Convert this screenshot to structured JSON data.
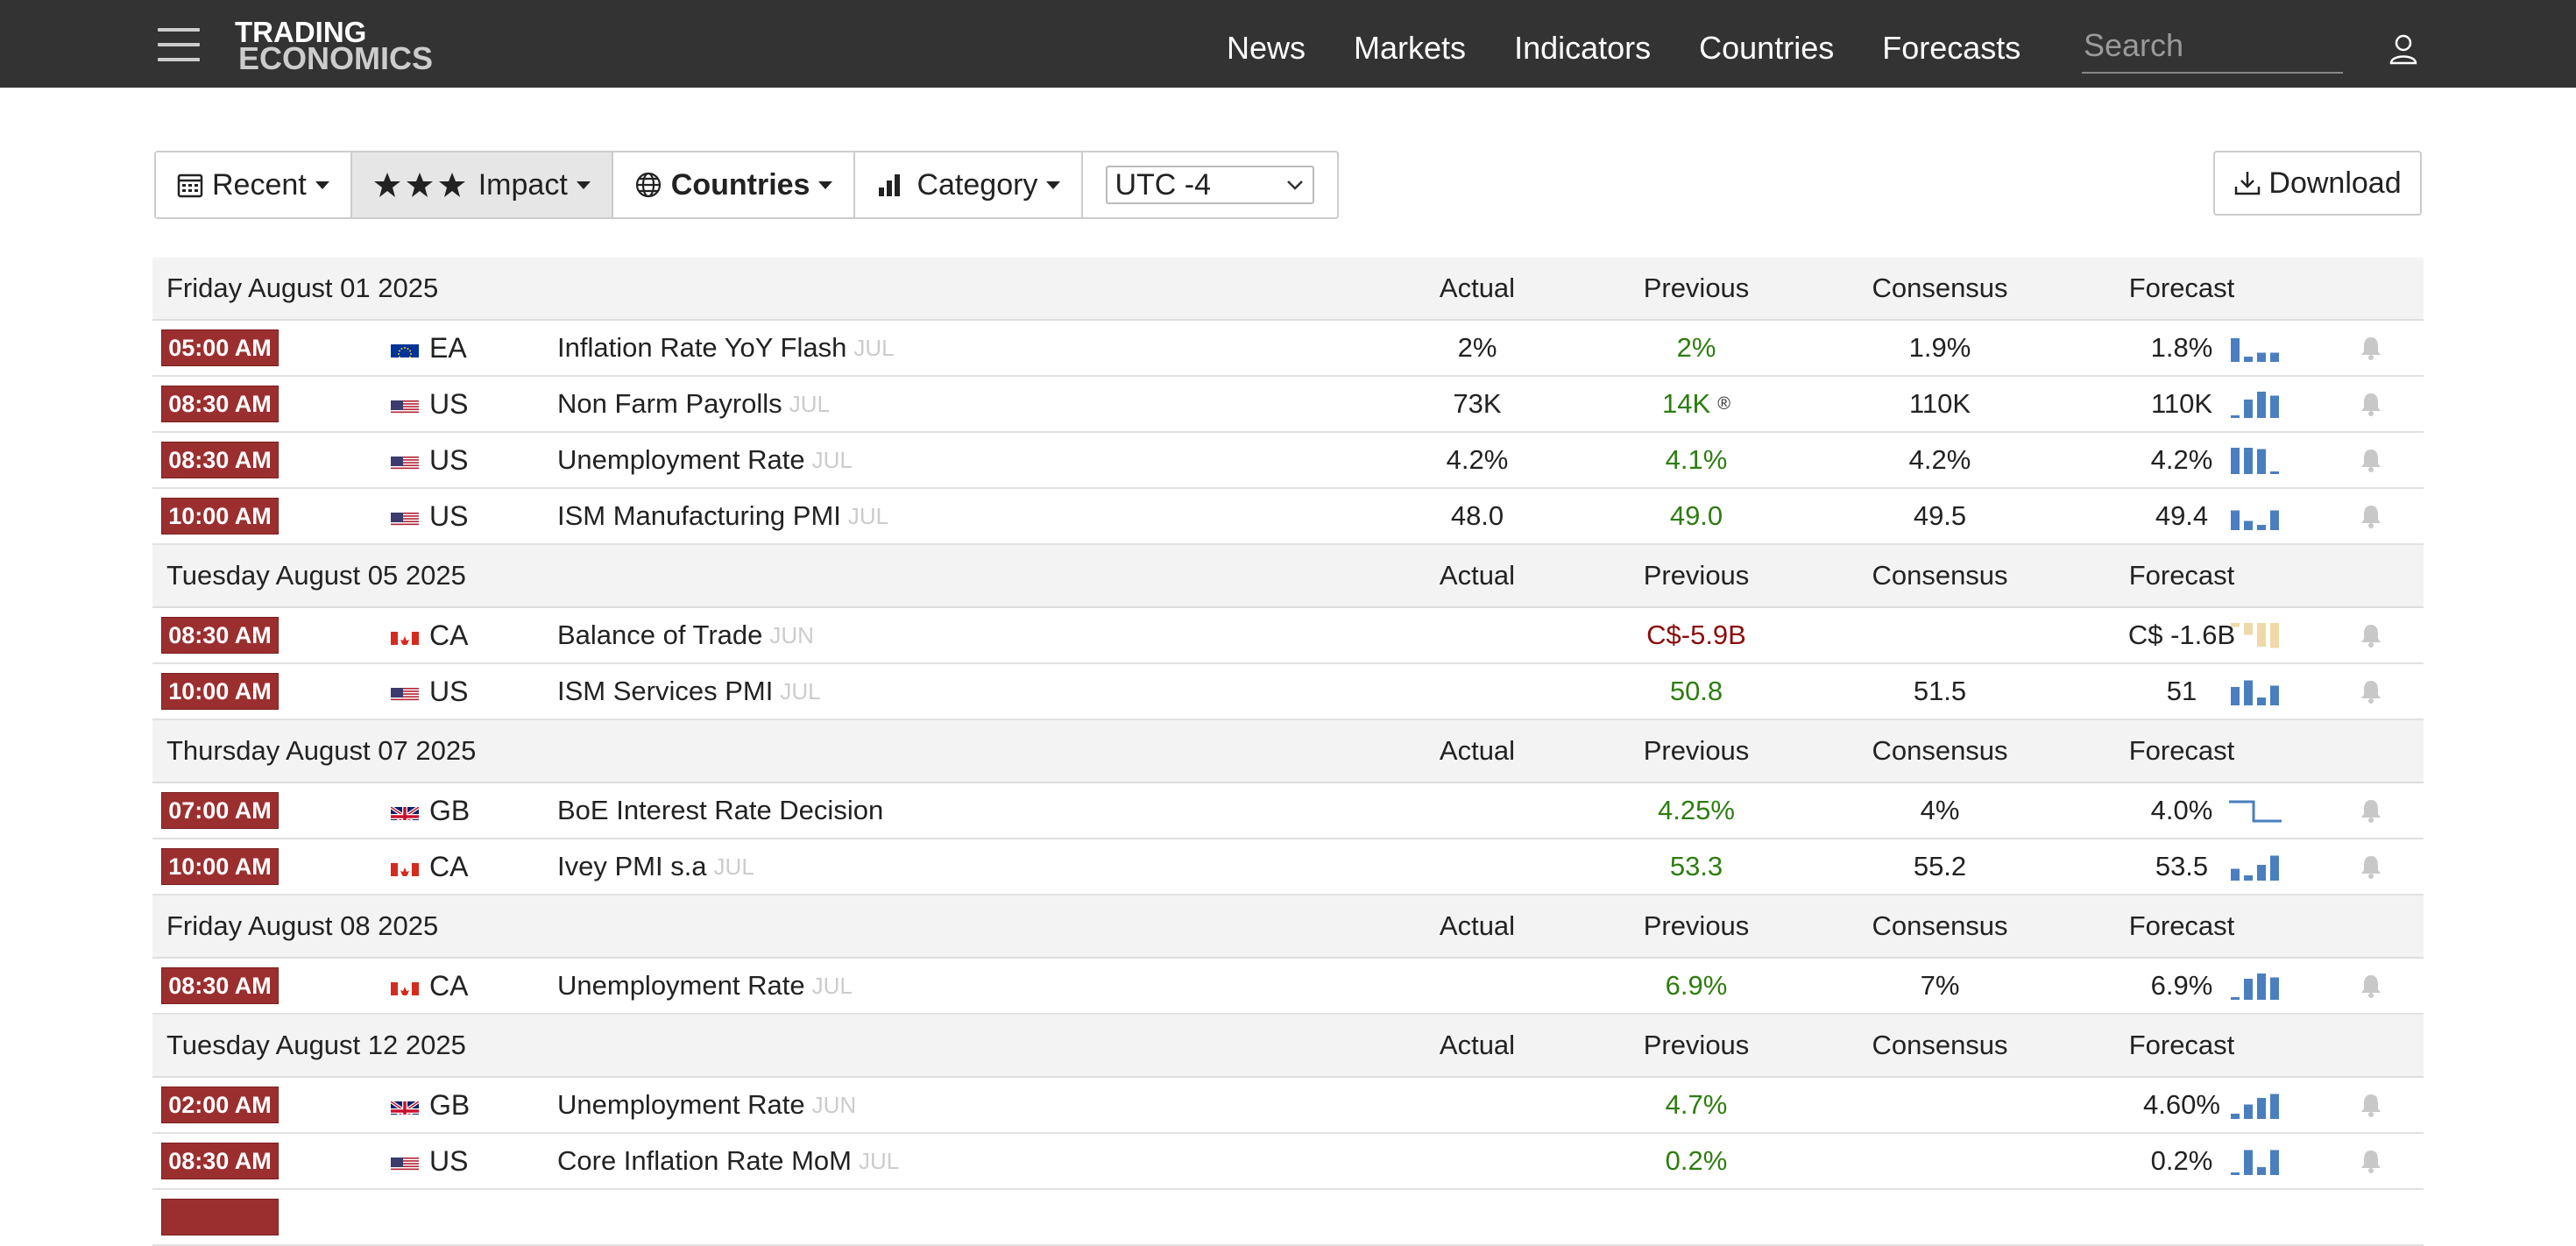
{
  "header": {
    "logo_line1": "TRADING",
    "logo_line2": "ECONOMICS",
    "nav": [
      "News",
      "Markets",
      "Indicators",
      "Countries",
      "Forecasts"
    ],
    "search_placeholder": "Search"
  },
  "filters": {
    "recent": "Recent",
    "impact": "Impact",
    "countries": "Countries",
    "category": "Category",
    "timezone": "UTC -4",
    "download": "Download"
  },
  "columns": {
    "actual": "Actual",
    "previous": "Previous",
    "consensus": "Consensus",
    "forecast": "Forecast"
  },
  "days": [
    {
      "date": "Friday August 01 2025",
      "events": [
        {
          "time": "05:00 AM",
          "flag": "eu",
          "country": "EA",
          "event": "Inflation Rate YoY Flash",
          "ref": "JUL",
          "actual": "2%",
          "previous": "2%",
          "prev_color": "green",
          "revised": "",
          "consensus": "1.9%",
          "forecast": "1.8%",
          "spark": [
            0.9,
            0.2,
            0.35,
            0.35
          ],
          "spark_color": "#4a7fbf"
        },
        {
          "time": "08:30 AM",
          "flag": "us",
          "country": "US",
          "event": "Non Farm Payrolls",
          "ref": "JUL",
          "actual": "73K",
          "previous": "14K",
          "prev_color": "green",
          "revised": "®",
          "consensus": "110K",
          "forecast": "110K",
          "spark": [
            0.1,
            0.7,
            1.0,
            0.85
          ],
          "spark_color": "#4a7fbf"
        },
        {
          "time": "08:30 AM",
          "flag": "us",
          "country": "US",
          "event": "Unemployment Rate",
          "ref": "JUL",
          "actual": "4.2%",
          "previous": "4.1%",
          "prev_color": "green",
          "revised": "",
          "consensus": "4.2%",
          "forecast": "4.2%",
          "spark": [
            1.0,
            1.0,
            0.95,
            0.1
          ],
          "spark_color": "#4a7fbf"
        },
        {
          "time": "10:00 AM",
          "flag": "us",
          "country": "US",
          "event": "ISM Manufacturing PMI",
          "ref": "JUL",
          "actual": "48.0",
          "previous": "49.0",
          "prev_color": "green",
          "revised": "",
          "consensus": "49.5",
          "forecast": "49.4",
          "spark": [
            0.75,
            0.35,
            0.2,
            0.75
          ],
          "spark_color": "#4a7fbf"
        }
      ]
    },
    {
      "date": "Tuesday August 05 2025",
      "events": [
        {
          "time": "08:30 AM",
          "flag": "ca",
          "country": "CA",
          "event": "Balance of Trade",
          "ref": "JUN",
          "actual": "",
          "previous": "C$-5.9B",
          "prev_color": "red",
          "revised": "",
          "consensus": "",
          "forecast": "C$ -1.6B",
          "spark": [
            0.15,
            0.45,
            0.9,
            0.95
          ],
          "spark_color": "#efd9a8",
          "spark_mode": "down"
        },
        {
          "time": "10:00 AM",
          "flag": "us",
          "country": "US",
          "event": "ISM Services PMI",
          "ref": "JUL",
          "actual": "",
          "previous": "50.8",
          "prev_color": "green",
          "revised": "",
          "consensus": "51.5",
          "forecast": "51",
          "spark": [
            0.7,
            0.95,
            0.3,
            0.75
          ],
          "spark_color": "#4a7fbf"
        }
      ]
    },
    {
      "date": "Thursday August 07 2025",
      "events": [
        {
          "time": "07:00 AM",
          "flag": "gb",
          "country": "GB",
          "event": "BoE Interest Rate Decision",
          "ref": "",
          "actual": "",
          "previous": "4.25%",
          "prev_color": "green",
          "revised": "",
          "consensus": "4%",
          "forecast": "4.0%",
          "spark_type": "step",
          "spark_color": "#4a7fbf"
        },
        {
          "time": "10:00 AM",
          "flag": "ca",
          "country": "CA",
          "event": "Ivey PMI s.a",
          "ref": "JUL",
          "actual": "",
          "previous": "53.3",
          "prev_color": "green",
          "revised": "",
          "consensus": "55.2",
          "forecast": "53.5",
          "spark": [
            0.45,
            0.2,
            0.6,
            0.95
          ],
          "spark_color": "#4a7fbf"
        }
      ]
    },
    {
      "date": "Friday August 08 2025",
      "events": [
        {
          "time": "08:30 AM",
          "flag": "ca",
          "country": "CA",
          "event": "Unemployment Rate",
          "ref": "JUL",
          "actual": "",
          "previous": "6.9%",
          "prev_color": "green",
          "revised": "",
          "consensus": "7%",
          "forecast": "6.9%",
          "spark": [
            0.1,
            0.8,
            1.0,
            0.85
          ],
          "spark_color": "#4a7fbf"
        }
      ]
    },
    {
      "date": "Tuesday August 12 2025",
      "events": [
        {
          "time": "02:00 AM",
          "flag": "gb",
          "country": "GB",
          "event": "Unemployment Rate",
          "ref": "JUN",
          "actual": "",
          "previous": "4.7%",
          "prev_color": "green",
          "revised": "",
          "consensus": "",
          "forecast": "4.60%",
          "spark": [
            0.2,
            0.55,
            0.8,
            0.95
          ],
          "spark_color": "#4a7fbf"
        },
        {
          "time": "08:30 AM",
          "flag": "us",
          "country": "US",
          "event": "Core Inflation Rate MoM",
          "ref": "JUL",
          "actual": "",
          "previous": "0.2%",
          "prev_color": "green",
          "revised": "",
          "consensus": "",
          "forecast": "0.2%",
          "spark": [
            0.1,
            0.95,
            0.3,
            0.95
          ],
          "spark_color": "#4a7fbf"
        }
      ]
    }
  ]
}
